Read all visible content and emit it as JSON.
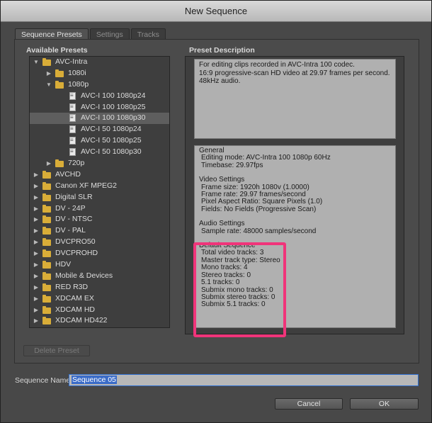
{
  "window": {
    "title": "New Sequence"
  },
  "tabs": [
    {
      "label": "Sequence Presets",
      "active": true
    },
    {
      "label": "Settings",
      "active": false
    },
    {
      "label": "Tracks",
      "active": false
    }
  ],
  "presets": {
    "heading": "Available Presets",
    "tree": [
      {
        "label": "AVC-Intra",
        "kind": "folder",
        "level": 0,
        "expanded": true
      },
      {
        "label": "1080i",
        "kind": "folder",
        "level": 1,
        "expanded": false
      },
      {
        "label": "1080p",
        "kind": "folder",
        "level": 1,
        "expanded": true
      },
      {
        "label": "AVC-I 100 1080p24",
        "kind": "file",
        "level": 2
      },
      {
        "label": "AVC-I 100 1080p25",
        "kind": "file",
        "level": 2
      },
      {
        "label": "AVC-I 100 1080p30",
        "kind": "file",
        "level": 2,
        "selected": true
      },
      {
        "label": "AVC-I 50 1080p24",
        "kind": "file",
        "level": 2
      },
      {
        "label": "AVC-I 50 1080p25",
        "kind": "file",
        "level": 2
      },
      {
        "label": "AVC-I 50 1080p30",
        "kind": "file",
        "level": 2
      },
      {
        "label": "720p",
        "kind": "folder",
        "level": 1,
        "expanded": false
      },
      {
        "label": "AVCHD",
        "kind": "folder",
        "level": 0,
        "expanded": false
      },
      {
        "label": "Canon XF MPEG2",
        "kind": "folder",
        "level": 0,
        "expanded": false
      },
      {
        "label": "Digital SLR",
        "kind": "folder",
        "level": 0,
        "expanded": false
      },
      {
        "label": "DV - 24P",
        "kind": "folder",
        "level": 0,
        "expanded": false
      },
      {
        "label": "DV - NTSC",
        "kind": "folder",
        "level": 0,
        "expanded": false
      },
      {
        "label": "DV - PAL",
        "kind": "folder",
        "level": 0,
        "expanded": false
      },
      {
        "label": "DVCPRO50",
        "kind": "folder",
        "level": 0,
        "expanded": false
      },
      {
        "label": "DVCPROHD",
        "kind": "folder",
        "level": 0,
        "expanded": false
      },
      {
        "label": "HDV",
        "kind": "folder",
        "level": 0,
        "expanded": false
      },
      {
        "label": "Mobile & Devices",
        "kind": "folder",
        "level": 0,
        "expanded": false
      },
      {
        "label": "RED R3D",
        "kind": "folder",
        "level": 0,
        "expanded": false
      },
      {
        "label": "XDCAM EX",
        "kind": "folder",
        "level": 0,
        "expanded": false
      },
      {
        "label": "XDCAM HD",
        "kind": "folder",
        "level": 0,
        "expanded": false
      },
      {
        "label": "XDCAM HD422",
        "kind": "folder",
        "level": 0,
        "expanded": false
      }
    ],
    "delete_label": "Delete Preset"
  },
  "description": {
    "heading": "Preset Description",
    "lines": [
      "For editing clips recorded in AVC-Intra 100 codec.",
      "16:9 progressive-scan HD video at 29.97 frames per second.",
      "48kHz audio."
    ],
    "sections": [
      {
        "title": "General",
        "items": [
          "Editing mode: AVC-Intra 100 1080p 60Hz",
          "Timebase: 29.97fps"
        ]
      },
      {
        "title": "Video Settings",
        "items": [
          "Frame size: 1920h 1080v (1.0000)",
          "Frame rate: 29.97 frames/second",
          "Pixel Aspect Ratio: Square Pixels (1.0)",
          "Fields: No Fields (Progressive Scan)"
        ]
      },
      {
        "title": "Audio Settings",
        "items": [
          "Sample rate: 48000 samples/second"
        ]
      },
      {
        "title": "Default Sequence",
        "items": [
          "Total video tracks: 3",
          "Master track type: Stereo",
          "Mono tracks: 4",
          "Stereo tracks: 0",
          "5.1 tracks: 0",
          "Submix mono tracks: 0",
          "Submix stereo tracks: 0",
          "Submix 5.1 tracks: 0"
        ]
      }
    ]
  },
  "sequence_name": {
    "label": "Sequence Name:",
    "value": "Sequence 05"
  },
  "buttons": {
    "cancel": "Cancel",
    "ok": "OK"
  },
  "colors": {
    "highlight": "#f0347a",
    "folder": "#d9ad38",
    "selection": "#3b6cc8"
  }
}
